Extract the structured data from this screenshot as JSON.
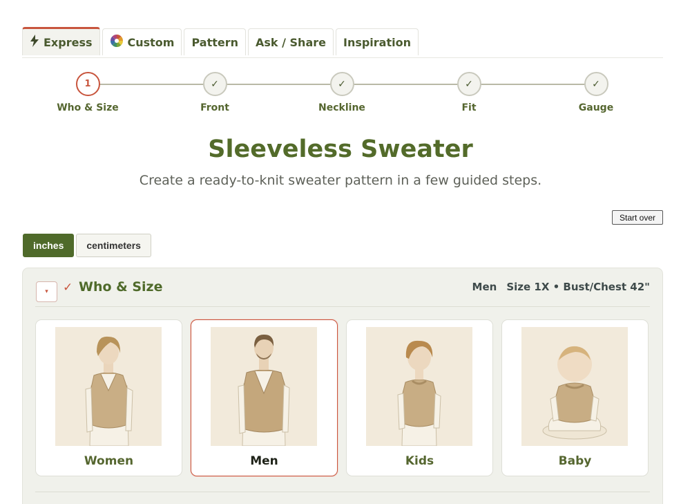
{
  "tabs": [
    {
      "label": "Express",
      "icon": "lightning-icon",
      "active": true
    },
    {
      "label": "Custom",
      "icon": "color-wheel-icon",
      "active": false
    },
    {
      "label": "Pattern",
      "active": false
    },
    {
      "label": "Ask / Share",
      "active": false
    },
    {
      "label": "Inspiration",
      "active": false
    }
  ],
  "steps": [
    {
      "number": "1",
      "label": "Who & Size",
      "state": "current"
    },
    {
      "check": "✓",
      "label": "Front",
      "state": "done"
    },
    {
      "check": "✓",
      "label": "Neckline",
      "state": "done"
    },
    {
      "check": "✓",
      "label": "Fit",
      "state": "done"
    },
    {
      "check": "✓",
      "label": "Gauge",
      "state": "done"
    }
  ],
  "page": {
    "title": "Sleeveless Sweater",
    "subtitle": "Create a ready-to-knit sweater pattern in a few guided steps.",
    "start_over": "Start over"
  },
  "units": {
    "inches": "inches",
    "centimeters": "centimeters",
    "selected": "inches"
  },
  "section": {
    "collapse_icon": "▾",
    "check": "✓",
    "title": "Who & Size",
    "summary_who": "Men",
    "summary_size": "Size 1X • Bust/Chest 42\""
  },
  "cards": [
    {
      "label": "Women",
      "selected": false
    },
    {
      "label": "Men",
      "selected": true
    },
    {
      "label": "Kids",
      "selected": false
    },
    {
      "label": "Baby",
      "selected": false
    }
  ],
  "colors": {
    "accent": "#c8553d",
    "brand_green": "#4f6a2a",
    "panel_bg": "#f0f1eb"
  }
}
